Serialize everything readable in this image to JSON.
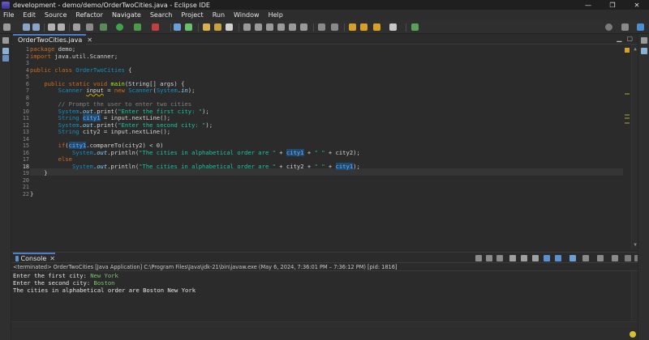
{
  "window": {
    "title": "development - demo/demo/OrderTwoCities.java - Eclipse IDE",
    "controls": [
      "—",
      "❐",
      "✕"
    ]
  },
  "menu": [
    "File",
    "Edit",
    "Source",
    "Refactor",
    "Navigate",
    "Search",
    "Project",
    "Run",
    "Window",
    "Help"
  ],
  "editor": {
    "tab_label": "OrderTwoCities.java",
    "tab_close": "✕",
    "line_numbers": [
      "1",
      "2",
      "3",
      "4",
      "5",
      "6",
      "7",
      "8",
      "9",
      "10",
      "11",
      "12",
      "13",
      "14",
      "15",
      "16",
      "17",
      "18",
      "19",
      "20",
      "21",
      "22"
    ],
    "current_line": 18
  },
  "console": {
    "tab_label": "Console",
    "tab_close": "✕",
    "description": "<terminated> OrderTwoCities [Java Application] C:\\Program Files\\Java\\jdk-21\\bin\\javaw.exe  (May 6, 2024, 7:36:01 PM – 7:36:12 PM) [pid: 1816]",
    "lines": [
      {
        "prompt": "Enter the first city: ",
        "input": "New York"
      },
      {
        "prompt": "Enter the second city: ",
        "input": "Boston"
      },
      {
        "prompt": "The cities in alphabetical order are Boston New York",
        "input": ""
      }
    ]
  },
  "colors": {
    "accent": "#4f7dc8",
    "keyword": "#cc6c1d",
    "type": "#1290c3",
    "string": "#17c6a3",
    "highlight": "#1d4c70"
  }
}
